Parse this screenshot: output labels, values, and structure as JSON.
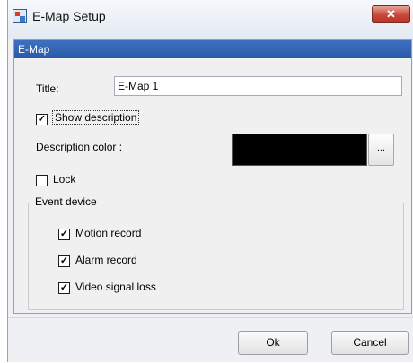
{
  "window": {
    "title": "E-Map Setup",
    "close_glyph": "✕"
  },
  "panel": {
    "header": "E-Map",
    "title_label": "Title:",
    "title_value": "E-Map 1",
    "show_description": {
      "label": "Show description",
      "checked": true
    },
    "description_color_label": "Description color :",
    "description_color": "#000000",
    "browse_label": "...",
    "lock": {
      "label": "Lock",
      "checked": false
    },
    "event_device": {
      "legend": "Event device",
      "items": [
        {
          "label": "Motion record",
          "checked": true
        },
        {
          "label": "Alarm record",
          "checked": true
        },
        {
          "label": "Video signal loss",
          "checked": true
        }
      ]
    }
  },
  "footer": {
    "ok_label": "Ok",
    "cancel_label": "Cancel"
  }
}
